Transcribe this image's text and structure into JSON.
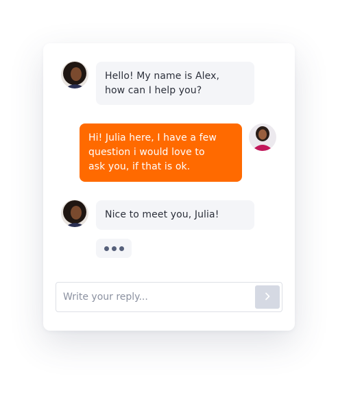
{
  "chat": {
    "messages": [
      {
        "sender": "Alex",
        "direction": "incoming",
        "lines": [
          "Hello! My name is Alex,",
          "how can I help you?"
        ]
      },
      {
        "sender": "Julia",
        "direction": "outgoing",
        "lines": [
          "Hi! Julia here, I have a few",
          "question i would love to",
          "ask you, if that is ok."
        ]
      },
      {
        "sender": "Alex",
        "direction": "incoming",
        "lines": [
          "Nice to meet you, Julia!"
        ]
      }
    ],
    "typing_indicator": "…",
    "reply": {
      "placeholder": "Write your reply...",
      "value": ""
    },
    "icons": {
      "send": "chevron-right-icon"
    }
  },
  "colors": {
    "accent": "#ff6a00",
    "incoming_bubble": "#f4f5f8",
    "send_button": "#d5d9e3"
  }
}
